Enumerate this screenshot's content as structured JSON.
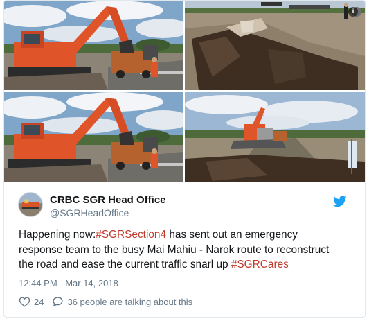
{
  "tweet": {
    "author_name": "CRBC SGR Head Office",
    "author_handle": "@SGRHeadOffice",
    "text_part_1": "Happening now:",
    "hashtag_1": "#SGRSection4",
    "text_part_2": " has sent out an emergency response team to the busy Mai Mahiu - Narok route to reconstruct the road and ease the current traffic snarl up ",
    "hashtag_2": "#SGRCares",
    "timestamp": "12:44 PM - Mar 14, 2018",
    "like_count": "24",
    "talking_text": "36 people are talking about this"
  },
  "media": {
    "info_label": "i",
    "photos": [
      {
        "icon": "excavator-photo"
      },
      {
        "icon": "road-crack-photo"
      },
      {
        "icon": "excavator-photo"
      },
      {
        "icon": "road-repair-photo"
      }
    ]
  },
  "colors": {
    "hashtag": "#c0392b",
    "muted": "#657786",
    "twitter_blue": "#1da1f2",
    "excavator": "#e0542a"
  },
  "icons": {
    "twitter": "twitter-bird-icon",
    "like": "heart-icon",
    "reply": "speech-bubble-icon"
  }
}
